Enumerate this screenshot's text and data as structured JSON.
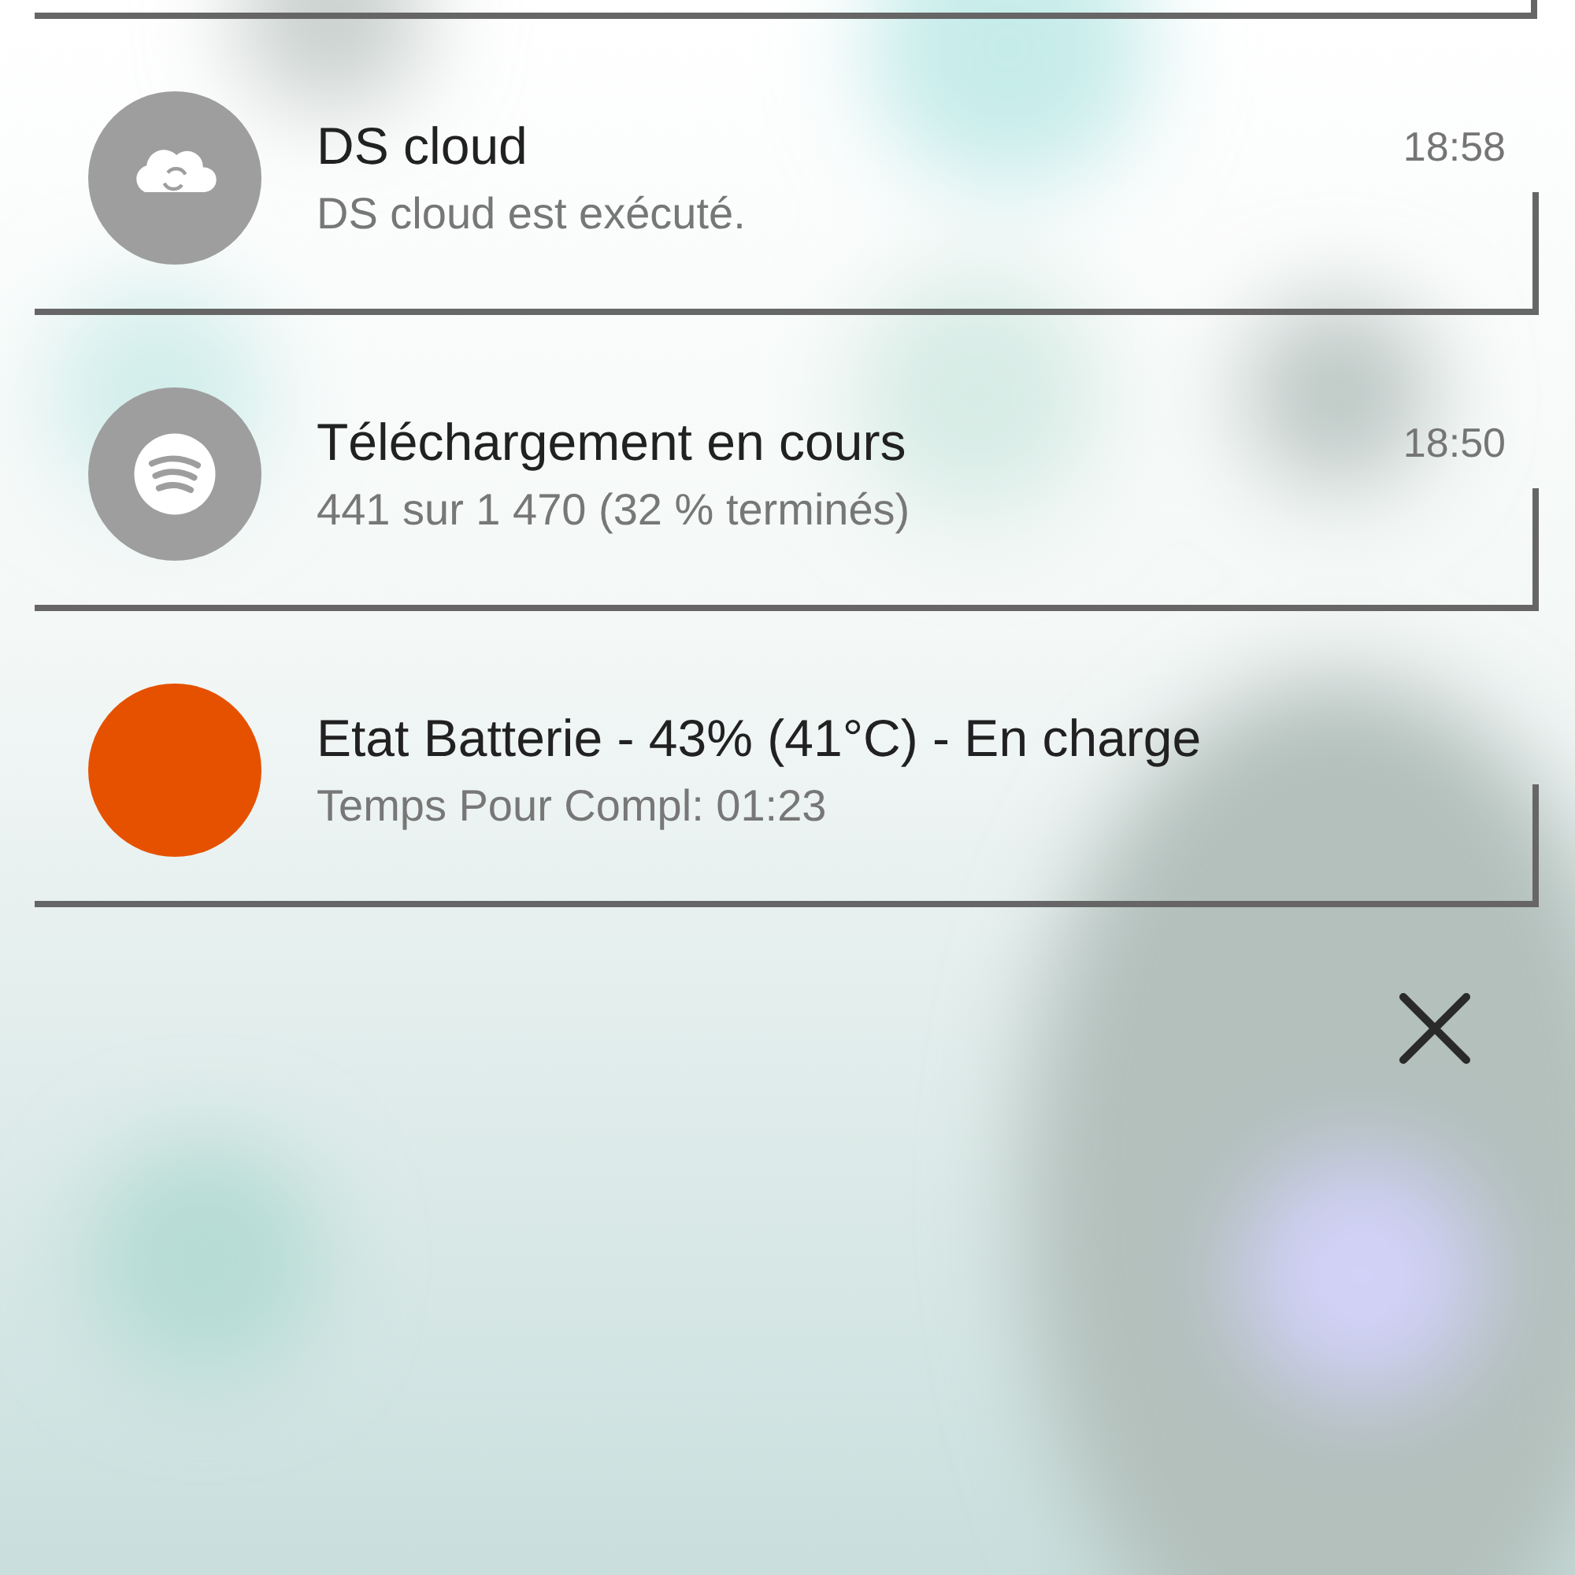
{
  "notifications": [
    {
      "icon": {
        "kind": "cloud",
        "color": "#9e9e9e"
      },
      "title": "DS cloud",
      "text": "DS cloud est exécuté.",
      "time": "18:58"
    },
    {
      "icon": {
        "kind": "waves",
        "color": "#9e9e9e"
      },
      "title": "Téléchargement en cours",
      "text": "441 sur 1 470 (32 % terminés)",
      "time": "18:50"
    },
    {
      "icon": {
        "kind": "plain",
        "color": "#e65100"
      },
      "title": "Etat Batterie - 43% (41°C) - En charge",
      "text": "Temps Pour Compl: 01:23"
    }
  ],
  "close_button": {
    "kind": "close"
  }
}
